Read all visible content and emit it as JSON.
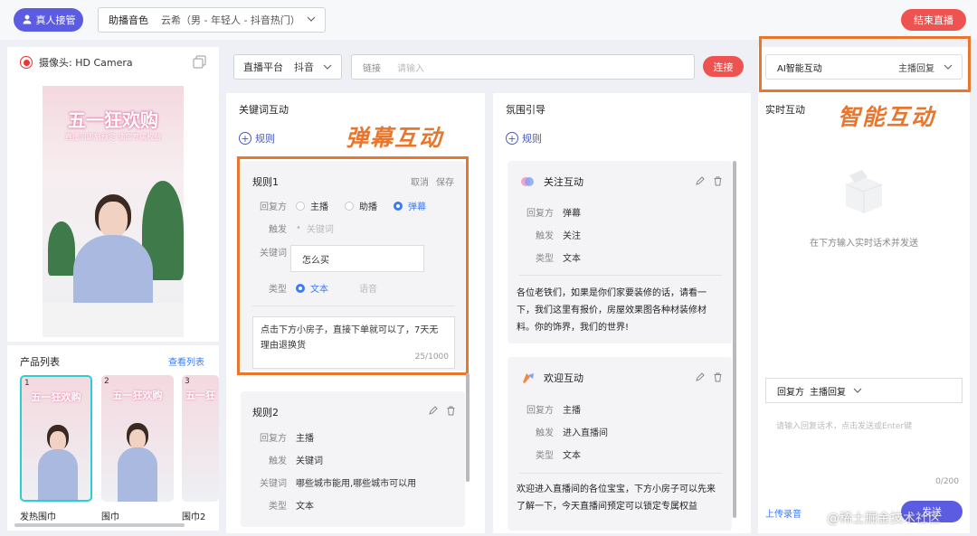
{
  "topbar": {
    "takeover_label": "真人接管",
    "voice_label": "助播音色",
    "voice_value": "云希（男 - 年轻人 - 抖音热门）",
    "end_live_label": "结束直播"
  },
  "camera": {
    "label": "摄像头: HD Camera"
  },
  "preview": {
    "banner_title": "五一狂欢购",
    "banner_sub": "直播间即刻预定 锁定专属权益"
  },
  "products": {
    "title": "产品列表",
    "view_all": "查看列表",
    "items": [
      {
        "index": "1",
        "name": "发热围巾",
        "thumb_title": "五一狂欢购"
      },
      {
        "index": "2",
        "name": "围巾",
        "thumb_title": "五一狂欢购"
      },
      {
        "index": "3",
        "name": "围巾2",
        "thumb_title": "五一狂"
      }
    ]
  },
  "platform": {
    "label": "直播平台",
    "value": "抖音",
    "link_label": "链接",
    "link_placeholder": "请输入",
    "connect_label": "连接"
  },
  "keyword": {
    "title": "关键词互动",
    "add_rule": "规则",
    "overlay": "弹幕互动",
    "rule1": {
      "title": "规则1",
      "cancel": "取消",
      "save": "保存",
      "reply_label": "回复方",
      "options": [
        "主播",
        "助播",
        "弹幕"
      ],
      "trigger_label": "触发",
      "trigger_value": "关键词",
      "keyword_label": "关键词",
      "keyword_value": "怎么买",
      "type_label": "类型",
      "type_options": [
        "文本",
        "语音"
      ],
      "text": "点击下方小房子，直接下单就可以了，7天无理由退换货",
      "count": "25/1000"
    },
    "rule2": {
      "title": "规则2",
      "reply_label": "回复方",
      "reply_value": "主播",
      "trigger_label": "触发",
      "trigger_value": "关键词",
      "keyword_label": "关键词",
      "keyword_value": "哪些城市能用,哪些城市可以用",
      "type_label": "类型",
      "type_value": "文本"
    }
  },
  "atmosphere": {
    "title": "氛围引导",
    "add_rule": "规则",
    "follow": {
      "title": "关注互动",
      "reply_label": "回复方",
      "reply_value": "弹幕",
      "trigger_label": "触发",
      "trigger_value": "关注",
      "type_label": "类型",
      "type_value": "文本",
      "message": "各位老铁们，如果是你们家要装修的话，请看一下，我们这里有报价，房屋效果图各种材装修材料。你的饰界，我们的世界!"
    },
    "welcome": {
      "title": "欢迎互动",
      "reply_label": "回复方",
      "reply_value": "主播",
      "trigger_label": "触发",
      "trigger_value": "进入直播间",
      "type_label": "类型",
      "type_value": "文本",
      "message": "欢迎进入直播间的各位宝宝，下方小房子可以先来了解一下，今天直播间预定可以锁定专属权益"
    }
  },
  "ai": {
    "mode_label": "AI智能互动",
    "mode_value": "主播回复",
    "realtime_title": "实时互动",
    "overlay": "智能互动",
    "empty_text": "在下方输入实时话术并发送",
    "reply_label": "回复方",
    "reply_value": "主播回复",
    "input_placeholder": "请输入回复话术，点击发送或Enter键",
    "count": "0/200",
    "upload_label": "上传录音",
    "send_label": "发送"
  },
  "watermark": "@稀土掘金技术社区",
  "colors": {
    "accent_purple": "#5b5ce2",
    "accent_red": "#ef5350",
    "highlight_orange": "#e8762c",
    "link_blue": "#3b7cf6"
  }
}
